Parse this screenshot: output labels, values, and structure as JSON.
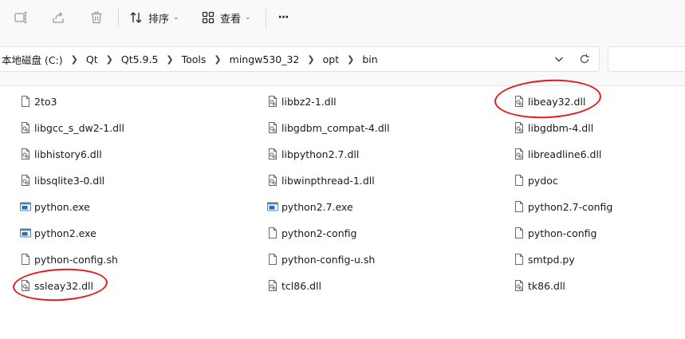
{
  "toolbar": {
    "sort_label": "排序",
    "view_label": "查看",
    "more_label": "···"
  },
  "address": {
    "crumbs": [
      "本地磁盘 (C:)",
      "Qt",
      "Qt5.9.5",
      "Tools",
      "mingw530_32",
      "opt",
      "bin"
    ]
  },
  "files": [
    {
      "name": "2to3",
      "type": "file"
    },
    {
      "name": "libbz2-1.dll",
      "type": "dll"
    },
    {
      "name": "libeay32.dll",
      "type": "dll"
    },
    {
      "name": "libgcc_s_dw2-1.dll",
      "type": "dll"
    },
    {
      "name": "libgdbm_compat-4.dll",
      "type": "dll"
    },
    {
      "name": "libgdbm-4.dll",
      "type": "dll"
    },
    {
      "name": "libhistory6.dll",
      "type": "dll"
    },
    {
      "name": "libpython2.7.dll",
      "type": "dll"
    },
    {
      "name": "libreadline6.dll",
      "type": "dll"
    },
    {
      "name": "libsqlite3-0.dll",
      "type": "dll"
    },
    {
      "name": "libwinpthread-1.dll",
      "type": "dll"
    },
    {
      "name": "pydoc",
      "type": "file"
    },
    {
      "name": "python.exe",
      "type": "exe"
    },
    {
      "name": "python2.7.exe",
      "type": "exe"
    },
    {
      "name": "python2.7-config",
      "type": "file"
    },
    {
      "name": "python2.exe",
      "type": "exe"
    },
    {
      "name": "python2-config",
      "type": "file"
    },
    {
      "name": "python-config",
      "type": "file"
    },
    {
      "name": "python-config.sh",
      "type": "file"
    },
    {
      "name": "python-config-u.sh",
      "type": "file"
    },
    {
      "name": "smtpd.py",
      "type": "file"
    },
    {
      "name": "ssleay32.dll",
      "type": "dll"
    },
    {
      "name": "tcl86.dll",
      "type": "dll"
    },
    {
      "name": "tk86.dll",
      "type": "dll"
    }
  ],
  "colors": {
    "annotation": "#e31b1b",
    "exe_blue": "#1e6fc9"
  }
}
